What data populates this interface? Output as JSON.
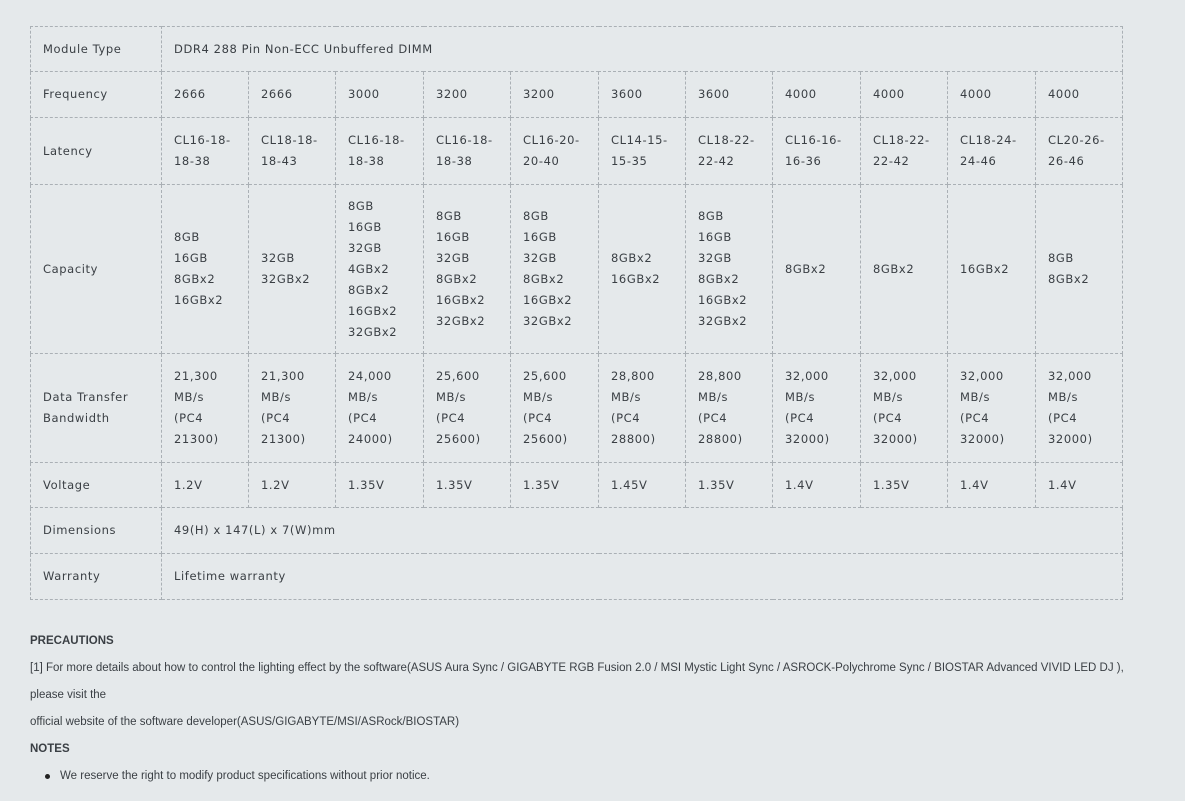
{
  "table": {
    "module_type": {
      "label": "Module Type",
      "value": "DDR4 288 Pin Non-ECC Unbuffered DIMM"
    },
    "frequency": {
      "label": "Frequency",
      "values": [
        "2666",
        "2666",
        "3000",
        "3200",
        "3200",
        "3600",
        "3600",
        "4000",
        "4000",
        "4000",
        "4000"
      ]
    },
    "latency": {
      "label": "Latency",
      "values": [
        [
          "CL16-18-",
          "18-38"
        ],
        [
          "CL18-18-",
          "18-43"
        ],
        [
          "CL16-18-",
          "18-38"
        ],
        [
          "CL16-18-",
          "18-38"
        ],
        [
          "CL16-20-",
          "20-40"
        ],
        [
          "CL14-15-",
          "15-35"
        ],
        [
          "CL18-22-",
          "22-42"
        ],
        [
          "CL16-16-",
          "16-36"
        ],
        [
          "CL18-22-",
          "22-42"
        ],
        [
          "CL18-24-",
          "24-46"
        ],
        [
          "CL20-26-",
          "26-46"
        ]
      ]
    },
    "capacity": {
      "label": "Capacity",
      "values": [
        [
          "8GB",
          "16GB",
          "8GBx2",
          "16GBx2"
        ],
        [
          "32GB",
          "32GBx2"
        ],
        [
          "8GB",
          "16GB",
          "32GB",
          "4GBx2",
          "8GBx2",
          "16GBx2",
          "32GBx2"
        ],
        [
          "8GB",
          "16GB",
          "32GB",
          "8GBx2",
          "16GBx2",
          "32GBx2"
        ],
        [
          "8GB",
          "16GB",
          "32GB",
          "8GBx2",
          "16GBx2",
          "32GBx2"
        ],
        [
          "8GBx2",
          "16GBx2"
        ],
        [
          "8GB",
          "16GB",
          "32GB",
          "8GBx2",
          "16GBx2",
          "32GBx2"
        ],
        [
          "8GBx2"
        ],
        [
          "8GBx2"
        ],
        [
          "16GBx2"
        ],
        [
          "8GB",
          "8GBx2"
        ]
      ]
    },
    "bandwidth": {
      "label_lines": [
        "Data Transfer",
        "Bandwidth"
      ],
      "values": [
        [
          "21,300",
          "MB/s",
          "(PC4",
          "21300)"
        ],
        [
          "21,300",
          "MB/s",
          "(PC4",
          "21300)"
        ],
        [
          "24,000",
          "MB/s",
          "(PC4",
          "24000)"
        ],
        [
          "25,600",
          "MB/s",
          "(PC4",
          "25600)"
        ],
        [
          "25,600",
          "MB/s",
          "(PC4",
          "25600)"
        ],
        [
          "28,800",
          "MB/s",
          "(PC4",
          "28800)"
        ],
        [
          "28,800",
          "MB/s",
          "(PC4",
          "28800)"
        ],
        [
          "32,000",
          "MB/s",
          "(PC4",
          "32000)"
        ],
        [
          "32,000",
          "MB/s",
          "(PC4",
          "32000)"
        ],
        [
          "32,000",
          "MB/s",
          "(PC4",
          "32000)"
        ],
        [
          "32,000",
          "MB/s",
          "(PC4",
          "32000)"
        ]
      ]
    },
    "voltage": {
      "label": "Voltage",
      "values": [
        "1.2V",
        "1.2V",
        "1.35V",
        "1.35V",
        "1.35V",
        "1.45V",
        "1.35V",
        "1.4V",
        "1.35V",
        "1.4V",
        "1.4V"
      ]
    },
    "dimensions": {
      "label": "Dimensions",
      "value": "49(H) x 147(L) x 7(W)mm"
    },
    "warranty": {
      "label": "Warranty",
      "value": "Lifetime warranty"
    }
  },
  "precautions": {
    "heading": "PRECAUTIONS",
    "line1": "[1] For more details about how to control the lighting effect by the software(ASUS Aura Sync / GIGABYTE RGB Fusion 2.0 / MSI Mystic Light Sync / ASROCK-Polychrome Sync / BIOSTAR Advanced VIVID LED DJ ), please visit the",
    "line2": "official website of the software developer(ASUS/GIGABYTE/MSI/ASRock/BIOSTAR)"
  },
  "notes": {
    "heading": "NOTES",
    "items": [
      "We reserve the right to modify product specifications without prior notice."
    ]
  }
}
